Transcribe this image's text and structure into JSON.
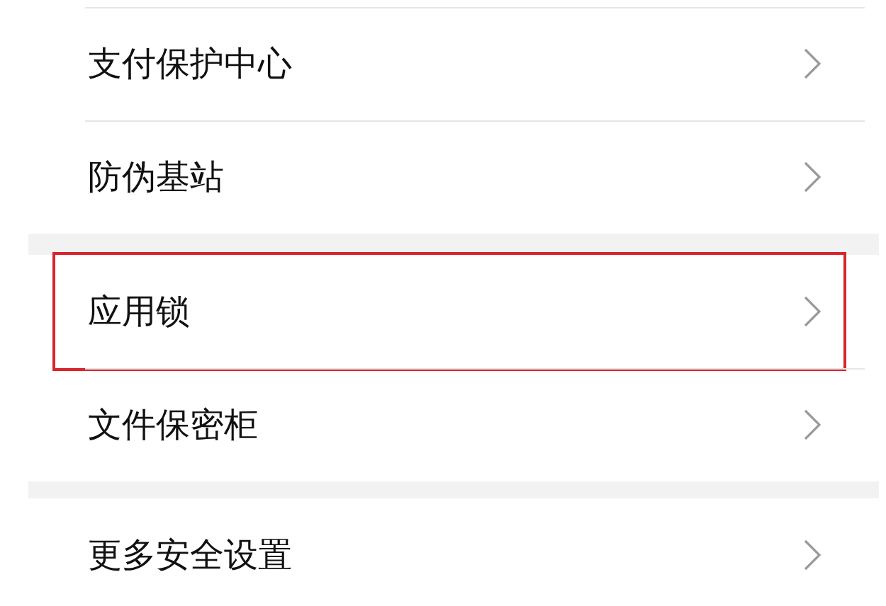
{
  "groups": [
    {
      "items": [
        {
          "label": "支付保护中心",
          "highlighted": false
        },
        {
          "label": "防伪基站",
          "highlighted": false
        }
      ]
    },
    {
      "items": [
        {
          "label": "应用锁",
          "highlighted": true
        },
        {
          "label": "文件保密柜",
          "highlighted": false
        }
      ]
    },
    {
      "items": [
        {
          "label": "更多安全设置",
          "highlighted": false
        }
      ]
    }
  ]
}
